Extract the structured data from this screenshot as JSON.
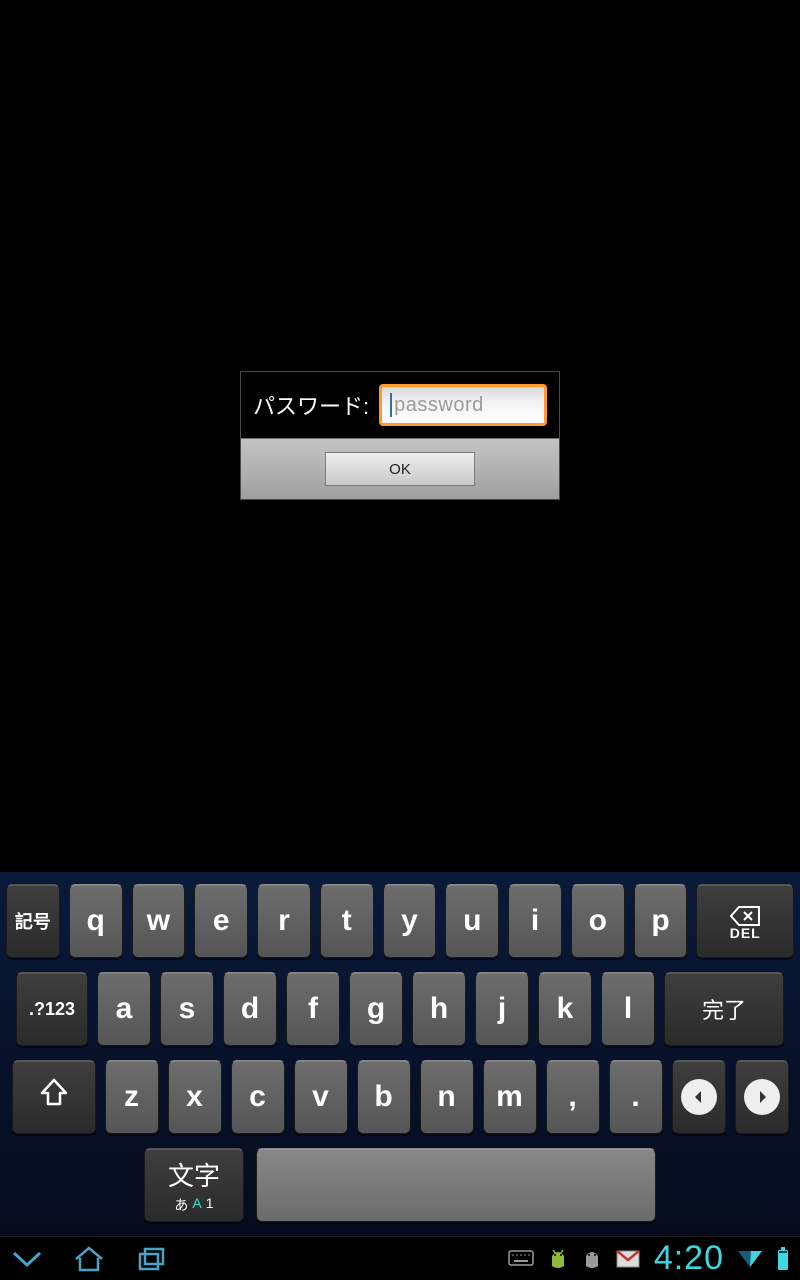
{
  "dialog": {
    "label": "パスワード:",
    "placeholder": "password",
    "ok_label": "OK"
  },
  "keyboard": {
    "row1": {
      "symbols": "記号",
      "keys": [
        "q",
        "w",
        "e",
        "r",
        "t",
        "y",
        "u",
        "i",
        "o",
        "p"
      ],
      "del_label": "DEL"
    },
    "row2": {
      "mode": ".?123",
      "keys": [
        "a",
        "s",
        "d",
        "f",
        "g",
        "h",
        "j",
        "k",
        "l"
      ],
      "done": "完了"
    },
    "row3": {
      "keys": [
        "z",
        "x",
        "c",
        "v",
        "b",
        "n",
        "m",
        ",",
        "."
      ]
    },
    "row4": {
      "moji_main": "文字",
      "moji_sub_a": "あ",
      "moji_sub_b": "A",
      "moji_sub_c": "1"
    }
  },
  "statusbar": {
    "time": "4:20",
    "icons": {
      "keyboard": "keyboard-icon",
      "android1": "android-icon",
      "android2": "android-icon",
      "mail": "mail-icon"
    }
  },
  "colors": {
    "accent": "#ff9a2a",
    "clock": "#3fd6df",
    "moji_highlight": "#2ee0d0"
  }
}
